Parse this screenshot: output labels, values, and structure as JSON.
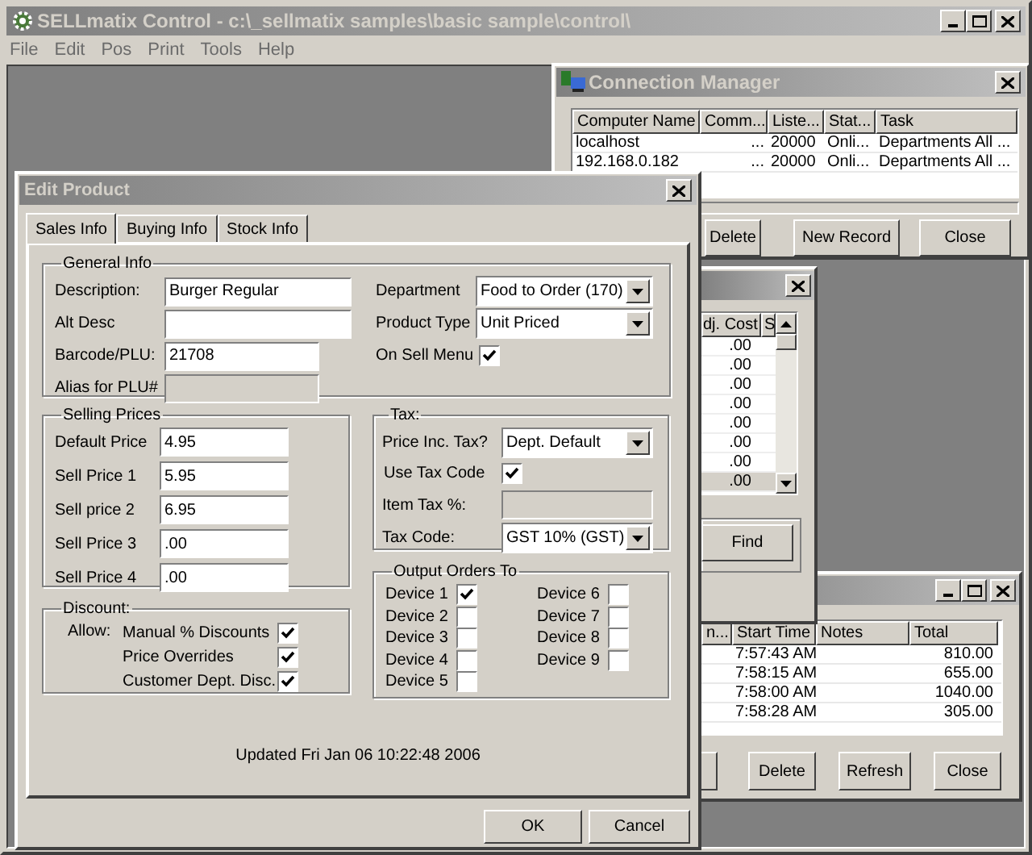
{
  "app": {
    "title": "SELLmatix Control - c:\\_sellmatix samples\\basic sample\\control\\",
    "menu": [
      "File",
      "Edit",
      "Pos",
      "Print",
      "Tools",
      "Help"
    ]
  },
  "connection_manager": {
    "title": "Connection Manager",
    "columns": [
      "Computer Name",
      "Comm...",
      "Liste...",
      "Stat...",
      "Task"
    ],
    "rows": [
      [
        "localhost",
        "...",
        "20000",
        "Onli...",
        "Departments All ..."
      ],
      [
        "192.168.0.182",
        "...",
        "20000",
        "Onli...",
        "Departments All ..."
      ]
    ],
    "buttons": [
      "Delete",
      "New Record",
      "Close"
    ]
  },
  "items_window": {
    "columns": [
      "dj. Cost",
      "S"
    ],
    "rows": [
      {
        "cost": ".00",
        "selected": false
      },
      {
        "cost": ".00",
        "selected": false
      },
      {
        "cost": ".00",
        "selected": false
      },
      {
        "cost": ".00",
        "selected": false
      },
      {
        "cost": ".00",
        "selected": false
      },
      {
        "cost": ".00",
        "selected": false
      },
      {
        "cost": ".00",
        "selected": false
      },
      {
        "cost": ".00",
        "selected": true
      }
    ],
    "buttons": [
      "Find"
    ]
  },
  "orders_window": {
    "columns": [
      "n...",
      "Start Time",
      "Notes",
      "Total"
    ],
    "rows": [
      {
        "start_time": "7:57:43 AM",
        "total": "810.00"
      },
      {
        "start_time": "7:58:15 AM",
        "total": "655.00"
      },
      {
        "start_time": "7:58:00 AM",
        "total": "1040.00"
      },
      {
        "start_time": "7:58:28 AM",
        "total": "305.00"
      }
    ],
    "buttons": [
      "Delete",
      "Refresh",
      "Close"
    ]
  },
  "edit_product": {
    "title": "Edit Product",
    "tabs": [
      {
        "label": "Sales Info",
        "selected": true
      },
      {
        "label": "Buying Info",
        "selected": false
      },
      {
        "label": "Stock Info",
        "selected": false
      }
    ],
    "general_info": {
      "title": "General Info",
      "fields": [
        {
          "label": "Description:",
          "value": "Burger Regular",
          "disabled": false
        },
        {
          "label": "Alt Desc",
          "disabled": false
        },
        {
          "label": "Barcode/PLU:",
          "value": "21708",
          "disabled": false
        },
        {
          "label": "Alias for PLU#",
          "disabled": true
        }
      ],
      "department": {
        "label": "Department",
        "value": "Food to Order (170)"
      },
      "product_type": {
        "label": "Product Type",
        "value": "Unit Priced"
      },
      "on_sell_menu": {
        "label": "On Sell Menu",
        "checked": true
      }
    },
    "selling_prices": {
      "title": "Selling Prices",
      "fields": [
        {
          "label": "Default Price",
          "value": "4.95"
        },
        {
          "label": "Sell Price 1",
          "value": "5.95"
        },
        {
          "label": "Sell price 2",
          "value": "6.95"
        },
        {
          "label": "Sell Price 3",
          "value": ".00"
        },
        {
          "label": "Sell Price 4",
          "value": ".00"
        }
      ]
    },
    "discount": {
      "title": "Discount:",
      "allow_label": "Allow:",
      "options": [
        {
          "label": "Manual % Discounts",
          "checked": true
        },
        {
          "label": "Price Overrides",
          "checked": true
        },
        {
          "label": "Customer Dept. Disc.",
          "checked": true
        }
      ]
    },
    "tax": {
      "title": "Tax:",
      "price_inc_tax": {
        "label": "Price Inc. Tax?",
        "value": "Dept. Default"
      },
      "use_tax_code": {
        "label": "Use Tax Code",
        "checked": true
      },
      "item_tax": {
        "label": "Item Tax %:",
        "disabled": true
      },
      "tax_code": {
        "label": "Tax Code:",
        "value": "GST 10% (GST)"
      }
    },
    "output_orders": {
      "title": "Output Orders To",
      "devices": [
        {
          "label": "Device 1",
          "checked": true
        },
        {
          "label": "Device 2",
          "checked": false
        },
        {
          "label": "Device 3",
          "checked": false
        },
        {
          "label": "Device 4",
          "checked": false
        },
        {
          "label": "Device 5",
          "checked": false
        },
        {
          "label": "Device 6",
          "checked": false
        },
        {
          "label": "Device 7",
          "checked": false
        },
        {
          "label": "Device 8",
          "checked": false
        },
        {
          "label": "Device 9",
          "checked": false
        }
      ]
    },
    "updated": "Updated Fri Jan 06 10:22:48 2006",
    "buttons": [
      "OK",
      "Cancel"
    ]
  }
}
